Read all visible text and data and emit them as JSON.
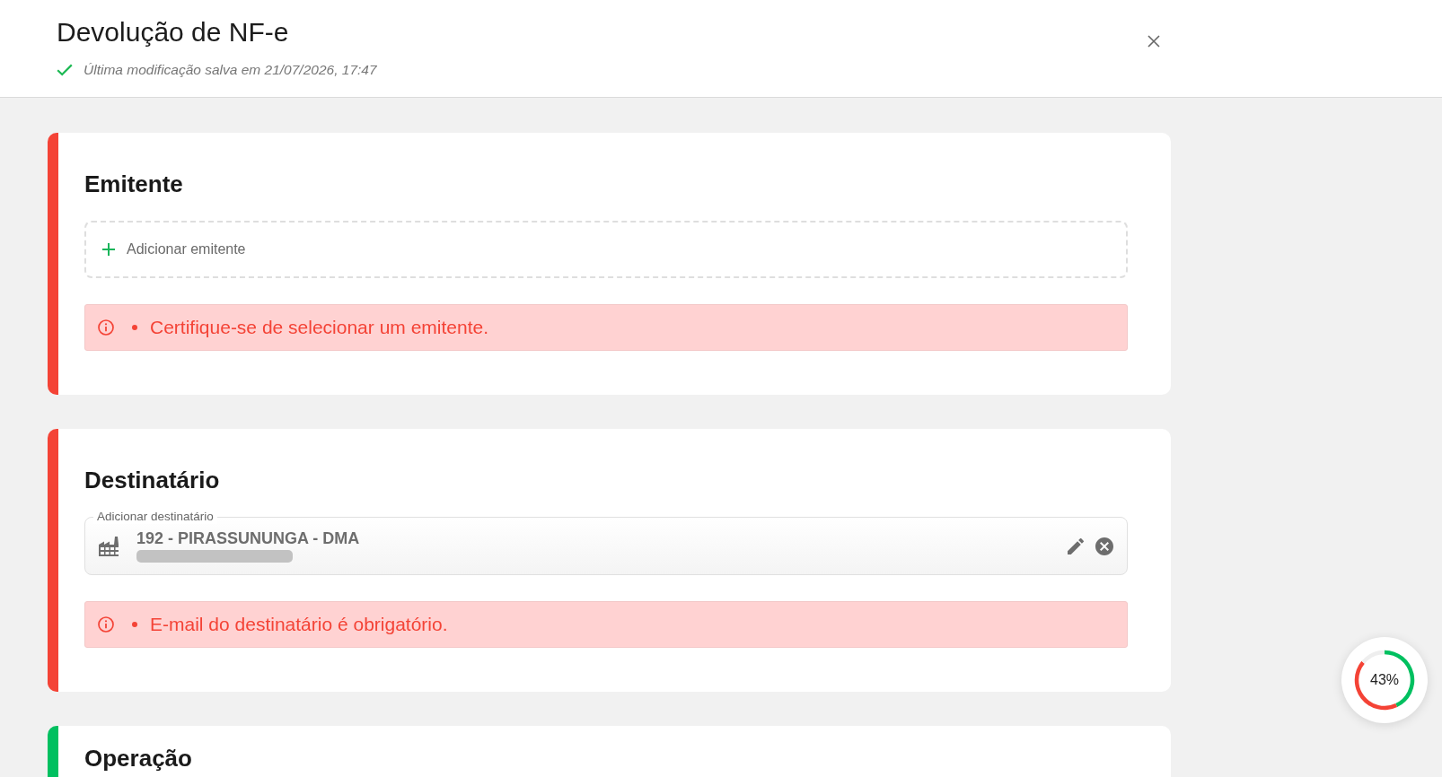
{
  "header": {
    "title": "Devolução de NF-e",
    "save_status": {
      "saved": true,
      "text": "Última modificação salva em 21/07/2026, 17:47"
    }
  },
  "sections": [
    {
      "title": "Emitente",
      "valid": false,
      "field": {
        "kind": "add",
        "label": "Adicionar emitente"
      },
      "errors": [
        "Certifique-se de selecionar um emitente."
      ]
    },
    {
      "title": "Destinatário",
      "valid": false,
      "field": {
        "kind": "selected",
        "legend": "Adicionar destinatário",
        "value": "192 - PIRASSUNUNGA - DMA"
      },
      "errors": [
        "E-mail do destinatário é obrigatório."
      ]
    },
    {
      "title": "Operação",
      "valid": true
    }
  ],
  "progress": {
    "label": "43%",
    "chart_data": {
      "type": "donut",
      "values": [
        43,
        43,
        14
      ]
    }
  }
}
